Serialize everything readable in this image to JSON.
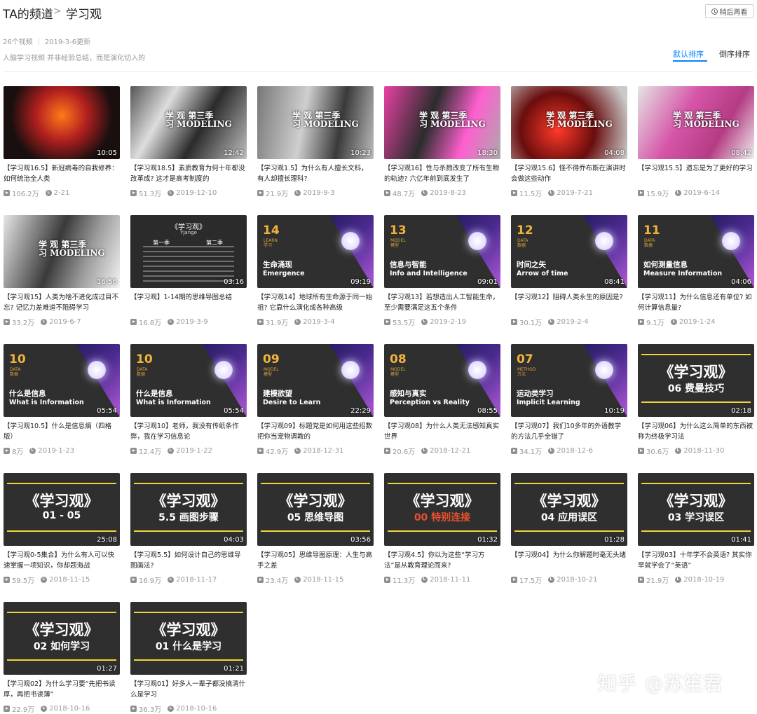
{
  "header": {
    "channel": "TA的频道",
    "separator": ">",
    "current": "学习观",
    "watch_later": "稍后再看"
  },
  "meta": {
    "video_count": "26个视频",
    "updated": "2019-3-6更新",
    "description": "人脑学习视频 并非经验总结，而是演化切入的"
  },
  "sort": {
    "default": "默认排序",
    "reverse": "倒序排序"
  },
  "videos": [
    {
      "title": "【学习观16.5】新冠病毒的自我修养：如何统治全人类",
      "views": "106.2万",
      "date": "2-21",
      "duration": "10:05",
      "thumb_type": "photo"
    },
    {
      "title": "【学习观18.5】素质教育为何十年都没改革成? 这才是高考制度的",
      "views": "51.3万",
      "date": "2019-12-10",
      "duration": "12:42",
      "thumb_type": "photo"
    },
    {
      "title": "【学习观1.5】为什么有人擅长文科，有人却擅长理科?",
      "views": "21.9万",
      "date": "2019-9-3",
      "duration": "10:23",
      "thumb_type": "photo"
    },
    {
      "title": "【学习观16】性与杀戮改变了所有生物的轨迹? 六亿年前到底发生了",
      "views": "48.7万",
      "date": "2019-8-23",
      "duration": "18:30",
      "thumb_type": "photo"
    },
    {
      "title": "【学习观15.6】怪不得乔布斯在演讲时会做这些动作",
      "views": "11.5万",
      "date": "2019-7-21",
      "duration": "04:08",
      "thumb_type": "photo"
    },
    {
      "title": "【学习观15.5】遗忘是为了更好的学习",
      "views": "15.9万",
      "date": "2019-6-14",
      "duration": "08:42",
      "thumb_type": "photo"
    },
    {
      "title": "【学习观15】人类为啥不进化成过目不忘? 记忆力差难道不阻碍学习",
      "views": "33.2万",
      "date": "2019-6-7",
      "duration": "16:56",
      "thumb_type": "photo"
    },
    {
      "title": "【学习观】1-14期的思维导图总结",
      "views": "16.8万",
      "date": "2019-3-9",
      "duration": "03:16",
      "thumb_type": "table"
    },
    {
      "title": "【学习观14】地球所有生命源于同一始祖? 它靠什么演化成各种高级",
      "views": "31.9万",
      "date": "2019-3-4",
      "duration": "09:19",
      "thumb_type": "dark",
      "num": "14",
      "tag_en": "LEARN",
      "tag_zh": "学习",
      "zh": "生命涌现",
      "en": "Emergence"
    },
    {
      "title": "【学习观13】若想造出人工智能生命，至少需要满足这五个条件",
      "views": "53.5万",
      "date": "2019-2-19",
      "duration": "09:01",
      "thumb_type": "dark",
      "num": "13",
      "tag_en": "MODEL",
      "tag_zh": "模型",
      "zh": "信息与智能",
      "en": "Info and Intelligence"
    },
    {
      "title": "【学习观12】阻碍人类永生的原因是?",
      "views": "30.1万",
      "date": "2019-2-4",
      "duration": "08:41",
      "thumb_type": "dark",
      "num": "12",
      "tag_en": "DATA",
      "tag_zh": "数据",
      "zh": "时间之矢",
      "en": "Arrow of time"
    },
    {
      "title": "【学习观11】为什么信息还有单位? 如何计算信息量?",
      "views": "9.1万",
      "date": "2019-1-24",
      "duration": "04:06",
      "thumb_type": "dark",
      "num": "11",
      "tag_en": "DATA",
      "tag_zh": "数据",
      "zh": "如何测量信息",
      "en": "Measure Information"
    },
    {
      "title": "【学习观10.5】什么是信息熵（四格版）",
      "views": "8万",
      "date": "2019-1-23",
      "duration": "05:54",
      "thumb_type": "dark",
      "num": "10",
      "tag_en": "DATA",
      "tag_zh": "数据",
      "zh": "什么是信息",
      "en": "What is Information"
    },
    {
      "title": "【学习观10】老师，我没有传纸条作弊，我在学习信息论",
      "views": "12.4万",
      "date": "2019-1-22",
      "duration": "05:54",
      "thumb_type": "dark",
      "num": "10",
      "tag_en": "DATA",
      "tag_zh": "数据",
      "zh": "什么是信息",
      "en": "What is Information"
    },
    {
      "title": "【学习观09】标题党是如何用这些招数把你当宠物调教的",
      "views": "42.9万",
      "date": "2018-12-31",
      "duration": "22:29",
      "thumb_type": "dark",
      "num": "09",
      "tag_en": "MODEL",
      "tag_zh": "模型",
      "zh": "建模欲望",
      "en": "Desire to Learn"
    },
    {
      "title": "【学习观08】为什么人类无法感知真实世界",
      "views": "20.6万",
      "date": "2018-12-21",
      "duration": "08:55",
      "thumb_type": "dark",
      "num": "08",
      "tag_en": "MODEL",
      "tag_zh": "模型",
      "zh": "感知与真实",
      "en": "Perception vs Reality"
    },
    {
      "title": "【学习观07】我们10多年的外语教学的方法几乎全错了",
      "views": "34.1万",
      "date": "2018-12-6",
      "duration": "10:19",
      "thumb_type": "dark",
      "num": "07",
      "tag_en": "METHOD",
      "tag_zh": "方法",
      "zh": "运动类学习",
      "en": "Implicit Learning"
    },
    {
      "title": "【学习观06】为什么这么简单的东西被称为终极学习法",
      "views": "30.6万",
      "date": "2018-11-30",
      "duration": "02:18",
      "thumb_type": "banner",
      "banner_title": "《学习观》",
      "banner_sub": "06 费曼技巧",
      "sub_color": "#ffffff"
    },
    {
      "title": "【学习观0-5集合】为什么有人可以快速掌握一项知识，你却题海战",
      "views": "59.5万",
      "date": "2018-11-15",
      "duration": "25:08",
      "thumb_type": "banner",
      "banner_title": "《学习观》",
      "banner_sub": "01 - 05",
      "sub_color": "#ffffff"
    },
    {
      "title": "【学习观5.5】如何设计自己的思维导图画法?",
      "views": "16.9万",
      "date": "2018-11-17",
      "duration": "04:03",
      "thumb_type": "banner",
      "banner_title": "《学习观》",
      "banner_sub": "5.5 画图步骤",
      "sub_color": "#ffffff"
    },
    {
      "title": "【学习观05】思维导图原理：人生与高手之差",
      "views": "23.4万",
      "date": "2018-11-15",
      "duration": "03:56",
      "thumb_type": "banner",
      "banner_title": "《学习观》",
      "banner_sub": "05 思维导图",
      "sub_color": "#ffffff"
    },
    {
      "title": "【学习观4.5】你以为这些“学习方法”是从教育理论而来?",
      "views": "11.3万",
      "date": "2018-11-11",
      "duration": "01:32",
      "thumb_type": "banner",
      "banner_title": "《学习观》",
      "banner_sub": "00 特别连接",
      "sub_color": "#e8502f"
    },
    {
      "title": "【学习观04】为什么你解题时毫无头绪",
      "views": "17.5万",
      "date": "2018-10-21",
      "duration": "01:28",
      "thumb_type": "banner",
      "banner_title": "《学习观》",
      "banner_sub": "04 应用误区",
      "sub_color": "#ffffff"
    },
    {
      "title": "【学习观03】十年学不会英语? 其实你早就学会了“英语”",
      "views": "21.9万",
      "date": "2018-10-19",
      "duration": "01:41",
      "thumb_type": "banner",
      "banner_title": "《学习观》",
      "banner_sub": "03 学习误区",
      "sub_color": "#ffffff"
    },
    {
      "title": "【学习观02】为什么学习要“先把书读厚，再把书读薄”",
      "views": "22.9万",
      "date": "2018-10-16",
      "duration": "01:27",
      "thumb_type": "banner",
      "banner_title": "《学习观》",
      "banner_sub": "02 如何学习",
      "sub_color": "#ffffff"
    },
    {
      "title": "【学习观01】好多人一辈子都没搞清什么是学习",
      "views": "36.3万",
      "date": "2018-10-16",
      "duration": "01:21",
      "thumb_type": "banner",
      "banner_title": "《学习观》",
      "banner_sub": "01 什么是学习",
      "sub_color": "#ffffff"
    }
  ],
  "photo_thumbs": {
    "label_line1": "学 观 第三季",
    "label_line2": "习 MODELING"
  },
  "table_thumb": {
    "title": "《学习观》",
    "subtitle": "YJango",
    "col1": "第一季",
    "col2": "第二季"
  },
  "watermark": "知乎 @苏笙君",
  "colors": {
    "accent": "#0084ff",
    "banner_line": "#f1d53a",
    "dark_num": "#f2b33c"
  }
}
